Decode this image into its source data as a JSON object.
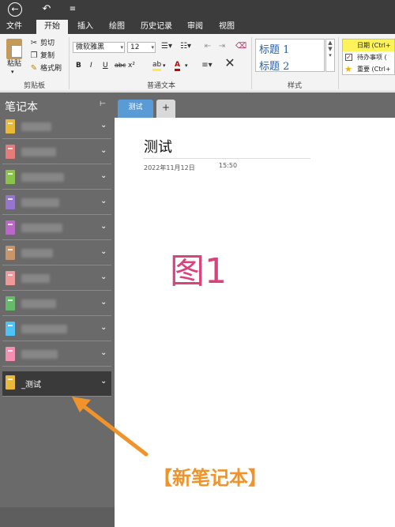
{
  "titlebar": {
    "back_icon": "back-circle-icon",
    "undo_glyph": "↶",
    "more_glyph": "≡"
  },
  "menu": {
    "tabs": [
      "文件",
      "开始",
      "插入",
      "绘图",
      "历史记录",
      "审阅",
      "视图"
    ],
    "active": "开始"
  },
  "ribbon": {
    "clipboard": {
      "paste": "粘贴",
      "cut": "剪切",
      "copy": "复制",
      "format_painter": "格式刷",
      "group_label": "剪贴板"
    },
    "text": {
      "font": "微软雅黑",
      "size": "12",
      "bold": "B",
      "italic": "I",
      "underline": "U",
      "strike": "abc",
      "superscript": "x²",
      "highlight": "ab",
      "font_color": "A",
      "group_label": "普通文本"
    },
    "styles": {
      "items": [
        "标题 1",
        "标题 2"
      ],
      "group_label": "样式"
    },
    "tags": {
      "items": [
        "日期 (Ctrl+",
        "待办事项 (",
        "重要 (Ctrl+"
      ]
    }
  },
  "sidebar": {
    "header": "笔记本",
    "pin_glyph": "⊢",
    "notebooks": [
      {
        "color": "#e8b93a"
      },
      {
        "color": "#e57b7b"
      },
      {
        "color": "#8bc34a"
      },
      {
        "color": "#9575cd"
      },
      {
        "color": "#ba68c8"
      },
      {
        "color": "#c9956b"
      },
      {
        "color": "#ef9a9a"
      },
      {
        "color": "#66bb6a"
      },
      {
        "color": "#4fc3f7"
      },
      {
        "color": "#f48fb1"
      }
    ],
    "active_notebook": {
      "label": "_测试",
      "color": "#e8b93a"
    },
    "chevron": "⌄"
  },
  "page_tabs": {
    "tab1": "测试",
    "add": "+"
  },
  "page": {
    "title": "测试",
    "date": "2022年11月12日",
    "time": "15:50",
    "figure_label": "图1"
  },
  "annotation": {
    "text": "【新笔记本】",
    "color": "#f0932a"
  },
  "colors": {
    "accent": "#5b9bd5",
    "sidebar_bg": "#6a6a6a",
    "titlebar_bg": "#3c3c3c",
    "figure_label": "#d9437b"
  }
}
